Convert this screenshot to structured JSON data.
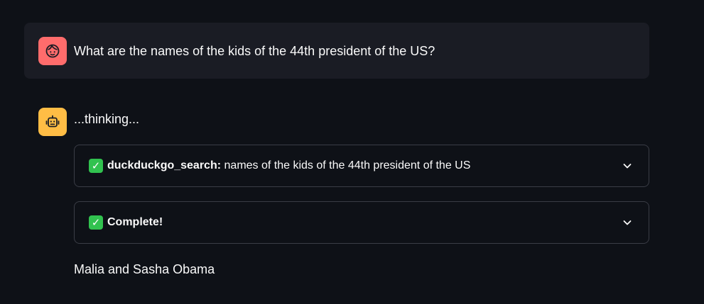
{
  "user_message": {
    "text": "What are the names of the kids of the 44th president of the US?",
    "avatar_icon": "face-icon",
    "avatar_color": "#ff6c6c"
  },
  "assistant": {
    "avatar_icon": "robot-icon",
    "avatar_color": "#ffbd45",
    "status_text": "...thinking...",
    "expanders": [
      {
        "status_icon": "check-mark-icon",
        "tool_name": "duckduckgo_search:",
        "tool_input": "names of the kids of the 44th president of the US",
        "expanded": false
      },
      {
        "status_icon": "check-mark-icon",
        "label": "Complete!",
        "expanded": false
      }
    ],
    "answer": "Malia and Sasha Obama"
  },
  "colors": {
    "background": "#0e1117",
    "user_bubble": "#1a1c24",
    "check_green": "#31c24f",
    "expander_border": "#3a3d46"
  }
}
